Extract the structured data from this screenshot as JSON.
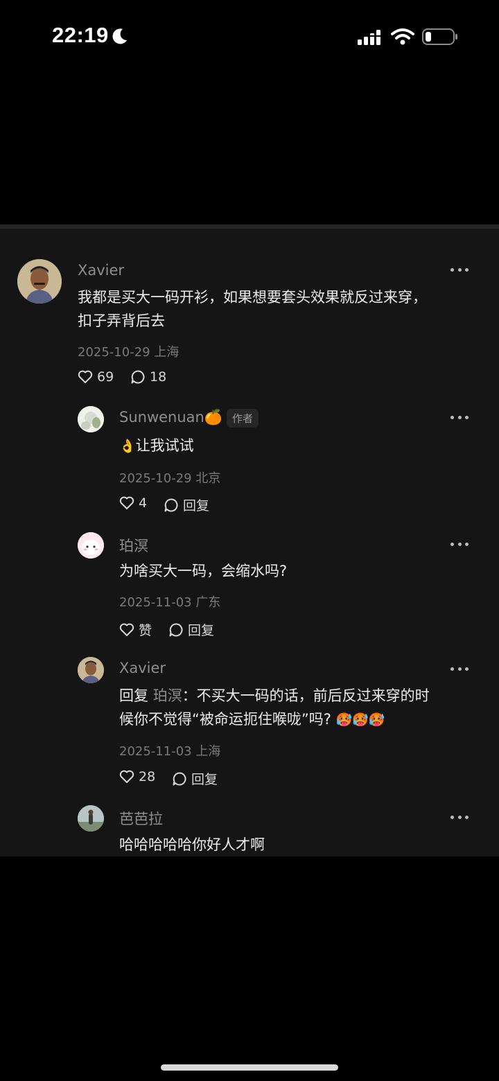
{
  "status_bar": {
    "time": "22:19"
  },
  "comments": [
    {
      "user": "Xavier",
      "text_lines": [
        "我都是买大一码开衫，如果想要套头效果就反过来穿，",
        "扣子弄背后去"
      ],
      "meta": "2025-10-29 上海",
      "likes": "69",
      "replies_count": "18",
      "replies": [
        {
          "user": "Sunwenuan",
          "name_emoji": "🍊",
          "badge": "作者",
          "emoji": "👌",
          "text": "让我试试",
          "meta": "2025-10-29 北京",
          "likes": "4",
          "reply_label": "回复"
        },
        {
          "user": "珀溟",
          "text": "为啥买大一码，会缩水吗?",
          "meta": "2025-11-03 广东",
          "likes": "赞",
          "reply_label": "回复"
        },
        {
          "user": "Xavier",
          "reply_prefix": "回复",
          "reply_to": "珀溟",
          "line1": "：不买大一码的话，前后反过来穿的时",
          "line2": "候你不觉得“被命运扼住喉咙”吗?",
          "line2_emojis": "🥵🥵🥵",
          "meta": "2025-11-03 上海",
          "likes": "28",
          "reply_label": "回复"
        },
        {
          "user": "芭芭拉",
          "text": "哈哈哈哈哈你好人才啊"
        }
      ]
    }
  ],
  "colors": {
    "background": "#000000",
    "panel": "#151515",
    "name": "#8e8e8e",
    "text": "#ececec"
  }
}
